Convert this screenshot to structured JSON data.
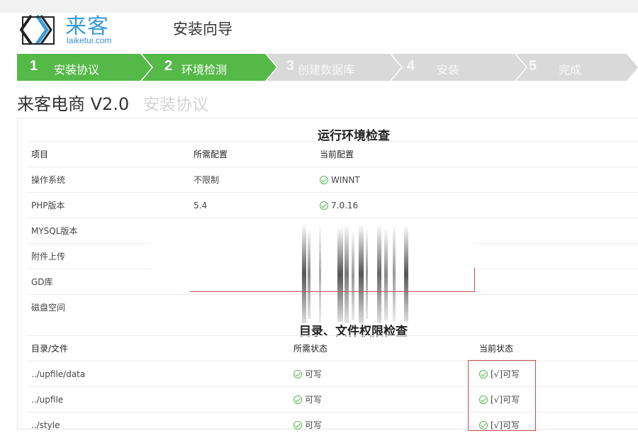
{
  "brand": {
    "name": "来客",
    "domain": "laiketui.com",
    "logo_icon": "laike-logo-icon"
  },
  "header": {
    "title": "安装向导"
  },
  "steps": [
    {
      "num": "1",
      "label": "安装协议",
      "state": "done"
    },
    {
      "num": "2",
      "label": "环境检测",
      "state": "active"
    },
    {
      "num": "3",
      "label": "创建数据库",
      "state": "pending"
    },
    {
      "num": "4",
      "label": "安装",
      "state": "pending"
    },
    {
      "num": "5",
      "label": "完成",
      "state": "pending"
    }
  ],
  "colors": {
    "active": "#54b947",
    "pending": "#d9d9d9",
    "accent": "#3a9bd9",
    "ok": "#55b84c",
    "highlight": "#c74b4b"
  },
  "product": {
    "name": "来客电商 V2.0",
    "subtitle": "安装协议"
  },
  "env_check": {
    "title": "运行环境检查",
    "columns": [
      "项目",
      "所需配置",
      "当前配置"
    ],
    "rows": [
      {
        "item": "操作系统",
        "required": "不限制",
        "current": "WINNT"
      },
      {
        "item": "PHP版本",
        "required": "5.4",
        "current": "7.0.16"
      },
      {
        "item": "MYSQL版本",
        "required": "",
        "current": ""
      },
      {
        "item": "附件上传",
        "required": "",
        "current": ""
      },
      {
        "item": "GD库",
        "required": "",
        "current": ""
      },
      {
        "item": "磁盘空间",
        "required": "",
        "current": ""
      }
    ]
  },
  "perm_check": {
    "title": "目录、文件权限检查",
    "columns": [
      "目录/文件",
      "所需状态",
      "当前状态"
    ],
    "rows": [
      {
        "path": "../upfile/data",
        "required": "可写",
        "current": "[√]可写"
      },
      {
        "path": "../upfile",
        "required": "可写",
        "current": "[√]可写"
      },
      {
        "path": "../style",
        "required": "可写",
        "current": "[√]可写"
      }
    ]
  }
}
